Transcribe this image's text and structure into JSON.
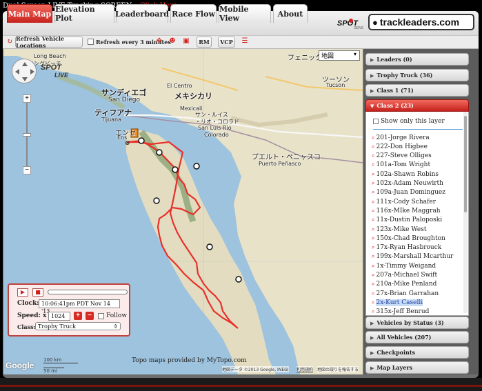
{
  "header": {
    "caption": "Dual Screen LIVE Tracking SCREEN –",
    "link": "Click Here"
  },
  "tabs": [
    {
      "label": "Main Map",
      "active": true
    },
    {
      "label": "Elevation Plot"
    },
    {
      "label": "Leaderboard"
    },
    {
      "label": "Race Flow"
    },
    {
      "label": "Mobile View"
    },
    {
      "label": "About"
    }
  ],
  "branding": {
    "spot": "SPOT",
    "spot_sub": "GEN3",
    "trackleaders": "trackleaders.com"
  },
  "toolbar": {
    "refresh_button": "Refresh Vehicle Locations",
    "refresh_every": "Refresh every 3 minutes",
    "rm_button": "RM",
    "vcp_button": "VCP"
  },
  "map": {
    "map_type": "地図",
    "labels": {
      "long_beach": "Long Beach",
      "long_beach_jp": "ロングビーチ",
      "san_diego_jp": "サンディエゴ",
      "san_diego": "San Diego",
      "mexicali_jp": "メキシカリ",
      "el_centro": "El Centro",
      "tijuana_jp": "ティフアナ",
      "tijuana": "Tijuana",
      "mexicali": "Mexicali",
      "san_luis_jp": "サン・ルイス",
      "san_luis_jp2": "・リオ・コロラド",
      "san_luis": "San Luis Rio",
      "colorado": "Colorado",
      "ensenada_jp": "エンセ",
      "ensenada": "Ens",
      "puerto_jp": "プエルト・ペニャスコ",
      "puerto": "Puerto Peñasco",
      "phoenix_jp": "フェニック",
      "tucson_jp": "ツーソン",
      "tucson": "Tucson"
    },
    "topo_credit": "Topo maps provided by MyTopo.com",
    "scale_km": "100 km",
    "scale_mi": "50 mi",
    "copyright": "地図データ ©2013 Google, INEGI",
    "terms": "利用規約",
    "report": "地図の誤りを報告する",
    "google": "Google",
    "colors": {
      "route": "#e8302a",
      "land": "#e8e2c9",
      "water": "#9ec3de"
    }
  },
  "playback": {
    "clock_label": "Clock:",
    "clock_value": "10:06:41pm PDT Nov 14 '13",
    "speed_label": "Speed: x",
    "speed_value": "1024",
    "follow_label": "Follow",
    "class_label": "Class:",
    "class_value": "Trophy Truck"
  },
  "sidebar": {
    "sections_top": [
      {
        "label": "Leaders (0)"
      },
      {
        "label": "Trophy Truck (36)"
      },
      {
        "label": "Class 1 (71)"
      }
    ],
    "open_section": "Class 2 (23)",
    "show_only": "Show only this layer",
    "racers": [
      "201-Jorge Rivera",
      "222-Don Higbee",
      "227-Steve Olliges",
      "101a-Tom Wright",
      "102a-Shawn Robins",
      "102x-Adam Neuwirth",
      "109a-Juan Dominguez",
      "111x-Cody Schafer",
      "116x-MIke Maggrah",
      "11x-Dustin Paloposki",
      "123x-Mike West",
      "150x-Chad Broughton",
      "17x-Ryan Hasbrouck",
      "199x-Marshall Mcarthur",
      "1x-Timmy Weigand",
      "207a-Michael Swift",
      "210a-Mike Penland",
      "27x-Brian Garrahan",
      "2x-Kurt Caselli",
      "315x-Jeff Benrud"
    ],
    "selected_racer": "2x-Kurt Caselli",
    "sections_bottom": [
      {
        "label": "Vehicles by Status (3)"
      },
      {
        "label": "All Vehicles (207)"
      },
      {
        "label": "Checkpoints"
      },
      {
        "label": "Map Layers"
      }
    ]
  }
}
